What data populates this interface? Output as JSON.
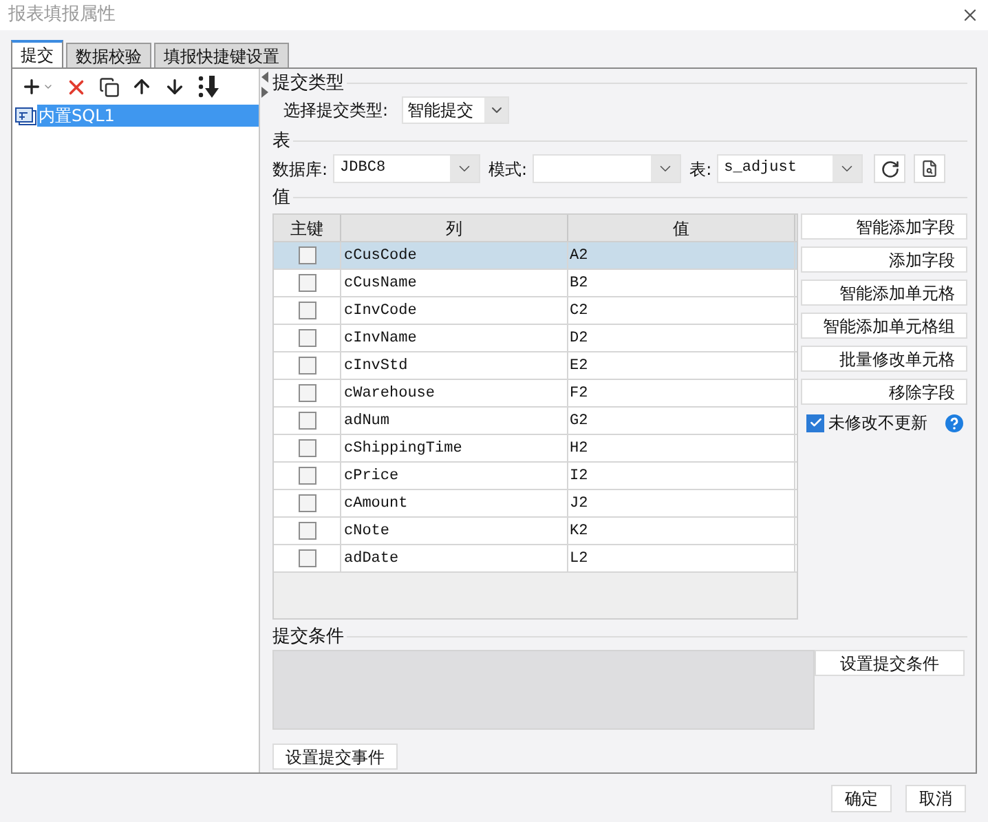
{
  "window": {
    "title": "报表填报属性"
  },
  "tabs": [
    {
      "label": "提交",
      "selected": true
    },
    {
      "label": "数据校验",
      "selected": false
    },
    {
      "label": "填报快捷键设置",
      "selected": false
    }
  ],
  "tree": {
    "items": [
      {
        "label": "内置SQL1",
        "selected": true
      }
    ]
  },
  "submit_type": {
    "heading": "提交类型",
    "label": "选择提交类型:",
    "value": "智能提交"
  },
  "table_section": {
    "heading": "表",
    "database_label": "数据库:",
    "database": "JDBC8",
    "schema_label": "模式:",
    "table_label": "表:",
    "table": "s_adjust"
  },
  "values": {
    "heading": "值",
    "columns": [
      "主键",
      "列",
      "值"
    ],
    "rows": [
      {
        "primary_key": false,
        "column": "cCusCode",
        "value": "A2",
        "selected": true
      },
      {
        "primary_key": false,
        "column": "cCusName",
        "value": "B2",
        "selected": false
      },
      {
        "primary_key": false,
        "column": "cInvCode",
        "value": "C2",
        "selected": false
      },
      {
        "primary_key": false,
        "column": "cInvName",
        "value": "D2",
        "selected": false
      },
      {
        "primary_key": false,
        "column": "cInvStd",
        "value": "E2",
        "selected": false
      },
      {
        "primary_key": false,
        "column": "cWarehouse",
        "value": "F2",
        "selected": false
      },
      {
        "primary_key": false,
        "column": "adNum",
        "value": "G2",
        "selected": false
      },
      {
        "primary_key": false,
        "column": "cShippingTime",
        "value": "H2",
        "selected": false
      },
      {
        "primary_key": false,
        "column": "cPrice",
        "value": "I2",
        "selected": false
      },
      {
        "primary_key": false,
        "column": "cAmount",
        "value": "J2",
        "selected": false
      },
      {
        "primary_key": false,
        "column": "cNote",
        "value": "K2",
        "selected": false
      },
      {
        "primary_key": false,
        "column": "adDate",
        "value": "L2",
        "selected": false
      }
    ],
    "buttons": [
      "智能添加字段",
      "添加字段",
      "智能添加单元格",
      "智能添加单元格组",
      "批量修改单元格",
      "移除字段"
    ],
    "no_update_unmodified": {
      "label": "未修改不更新",
      "checked": true
    }
  },
  "condition": {
    "heading": "提交条件",
    "button": "设置提交条件"
  },
  "event_button": "设置提交事件",
  "footer_buttons": [
    "确定",
    "取消"
  ]
}
